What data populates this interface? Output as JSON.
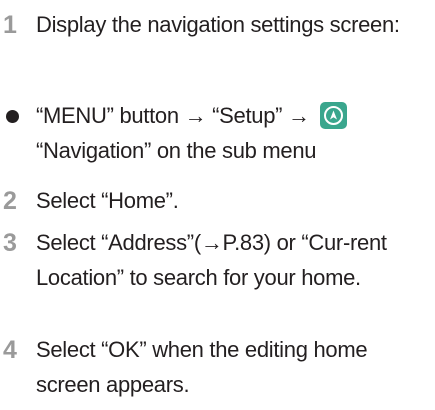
{
  "steps": [
    {
      "number": "1",
      "text": "Display the navigation settings screen:"
    },
    {
      "text_before_icon": "“MENU” button → “Setup” →",
      "icon": "navigation-compass-icon",
      "text_after_icon": "“Navigation” on the sub menu"
    },
    {
      "number": "2",
      "text": "Select “Home”."
    },
    {
      "number": "3",
      "text": "Select “Address”(→P.83) or “Cur-rent Location” to search for your home."
    },
    {
      "number": "4",
      "text": "Select “OK” when the editing home screen appears."
    }
  ],
  "colors": {
    "step_number": "#9a9a9a",
    "icon_bg": "#3aa68d",
    "text": "#231f20"
  }
}
